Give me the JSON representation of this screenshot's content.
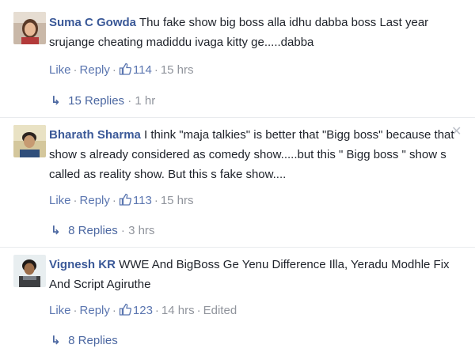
{
  "comments": [
    {
      "author": "Suma C Gowda",
      "text": "Thu fake show big boss alla idhu dabba boss Last year srujange cheating madiddu ivaga kitty ge.....dabba",
      "like_label": "Like",
      "reply_label": "Reply",
      "likes": "114",
      "time": "15 hrs",
      "replies_label": "15 Replies",
      "replies_time": "1 hr",
      "avatar_icon": "girl-avatar"
    },
    {
      "author": "Bharath Sharma",
      "text": "I think \"maja talkies\" is better that \"Bigg boss\" because that show s already considered as comedy show.....but this \" Bigg boss \" show s called as reality show. But this s fake show....",
      "like_label": "Like",
      "reply_label": "Reply",
      "likes": "113",
      "time": "15 hrs",
      "replies_label": "8 Replies",
      "replies_time": "3 hrs",
      "avatar_icon": "man-avatar"
    },
    {
      "author": "Vignesh KR",
      "text": "WWE And BigBoss Ge Yenu Difference Illa, Yeradu Modhle Fix And Script Agiruthe",
      "like_label": "Like",
      "reply_label": "Reply",
      "likes": "123",
      "time": "14 hrs",
      "edited": "Edited",
      "replies_label": "8 Replies",
      "avatar_icon": "man-avatar"
    }
  ],
  "close_glyph": "✕",
  "reply_arrow_glyph": "↳",
  "colors": {
    "link": "#3b5998",
    "muted": "#90949c",
    "text": "#1d2129"
  }
}
